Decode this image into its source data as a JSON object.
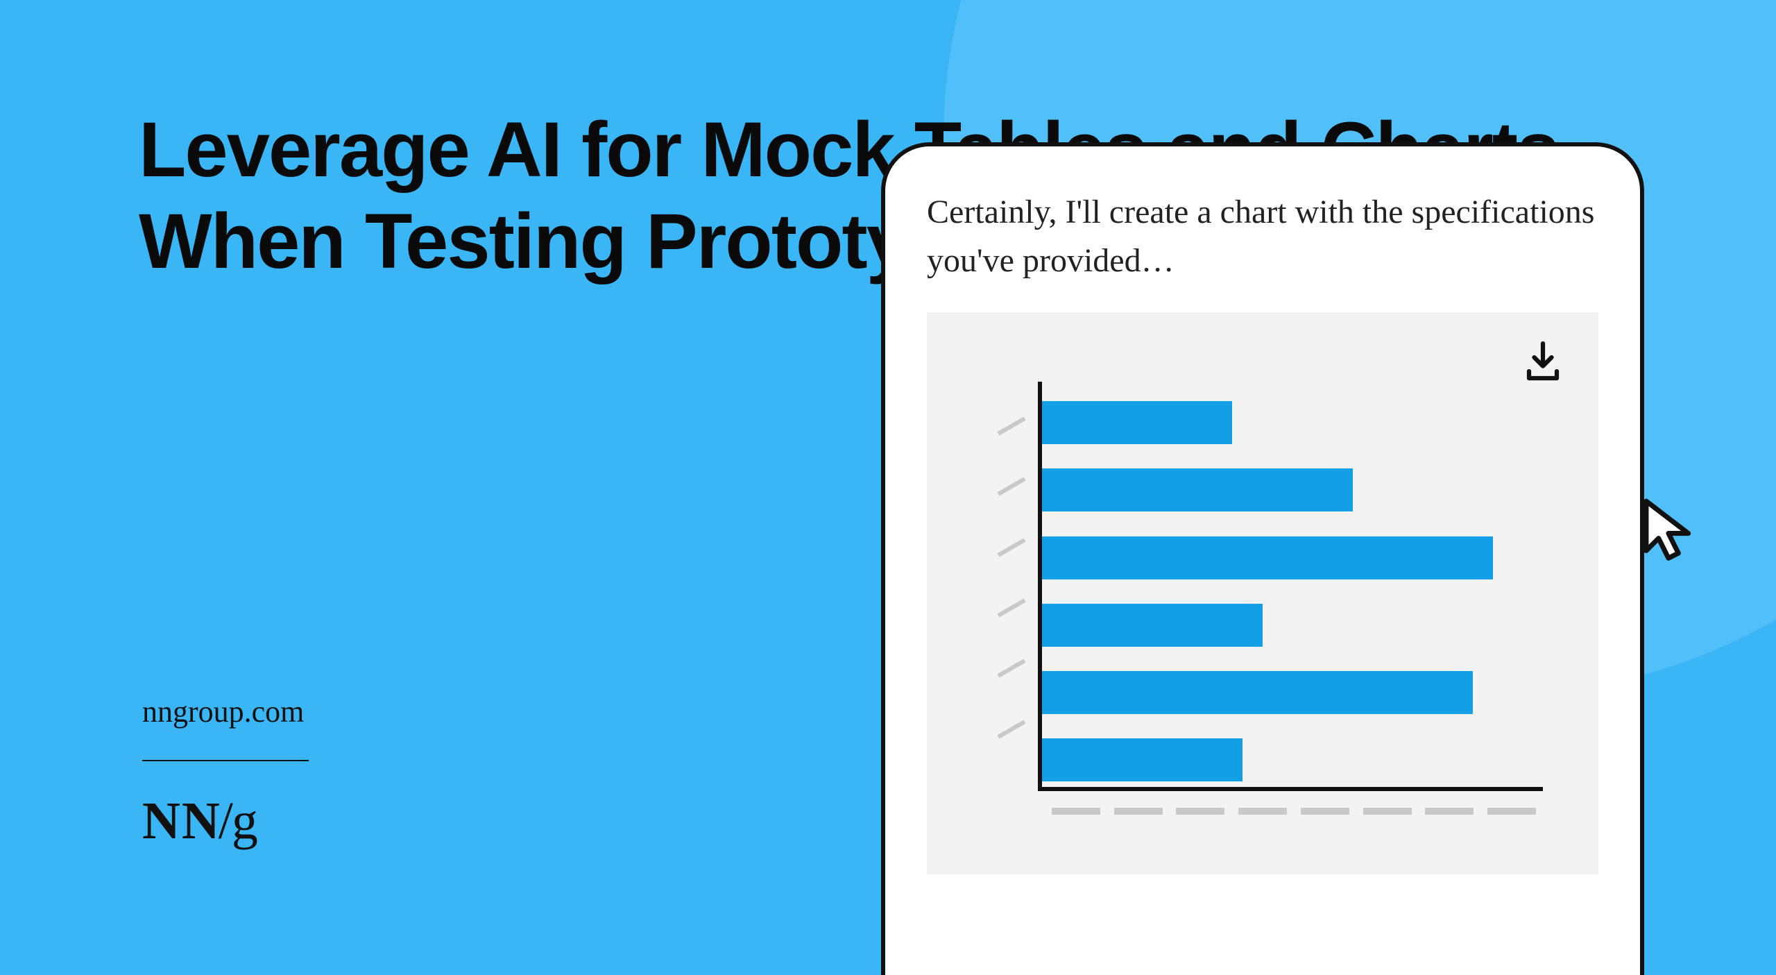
{
  "headline": "Leverage AI for Mock Tables and Charts When Testing Prototypes",
  "site_url": "nngroup.com",
  "logo": {
    "nn": "NN",
    "slash": "/",
    "g": "g"
  },
  "device": {
    "response_text": "Certainly, I'll create a chart with the specifications you've provided…"
  },
  "chart_data": {
    "type": "bar",
    "orientation": "horizontal",
    "values": [
      38,
      62,
      90,
      44,
      86,
      40
    ],
    "xlim": [
      0,
      100
    ],
    "y_ticks_count": 6,
    "x_ticks_count": 8
  },
  "colors": {
    "bg": "#3AB6F7",
    "bg_arc": "#52C0F8",
    "bar": "#139FE6",
    "ink": "#111111",
    "card": "#f3f3f3",
    "tick": "#c9c9c9"
  }
}
